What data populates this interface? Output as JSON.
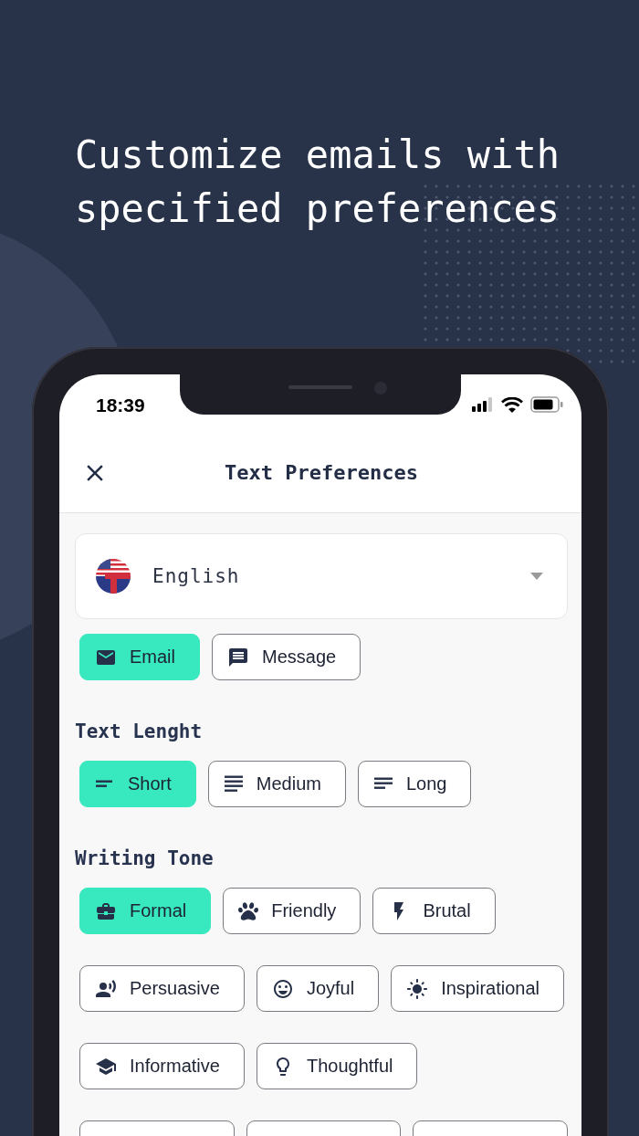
{
  "headline": "Customize emails with specified preferences",
  "status_bar": {
    "time": "18:39"
  },
  "header": {
    "title": "Text Preferences"
  },
  "language": {
    "value": "English"
  },
  "format_options": [
    {
      "kind": "email",
      "label": "Email",
      "selected": true
    },
    {
      "kind": "message",
      "label": "Message",
      "selected": false
    }
  ],
  "sections": [
    {
      "title": "Text Lenght",
      "rows": [
        [
          {
            "kind": "short",
            "label": "Short",
            "selected": true
          },
          {
            "kind": "medium",
            "label": "Medium",
            "selected": false
          },
          {
            "kind": "long",
            "label": "Long",
            "selected": false
          }
        ]
      ]
    },
    {
      "title": "Writing Tone",
      "rows": [
        [
          {
            "kind": "formal",
            "label": "Formal",
            "selected": true
          },
          {
            "kind": "friendly",
            "label": "Friendly",
            "selected": false
          },
          {
            "kind": "brutal",
            "label": "Brutal",
            "selected": false
          }
        ],
        [
          {
            "kind": "persuasive",
            "label": "Persuasive",
            "selected": false
          },
          {
            "kind": "joyful",
            "label": "Joyful",
            "selected": false
          },
          {
            "kind": "inspirational",
            "label": "Inspirational",
            "selected": false
          }
        ],
        [
          {
            "kind": "informative",
            "label": "Informative",
            "selected": false
          },
          {
            "kind": "thoughtful",
            "label": "Thoughtful",
            "selected": false
          }
        ],
        [
          {
            "selected": false
          },
          {
            "selected": false
          },
          {
            "selected": false
          }
        ]
      ]
    }
  ]
}
